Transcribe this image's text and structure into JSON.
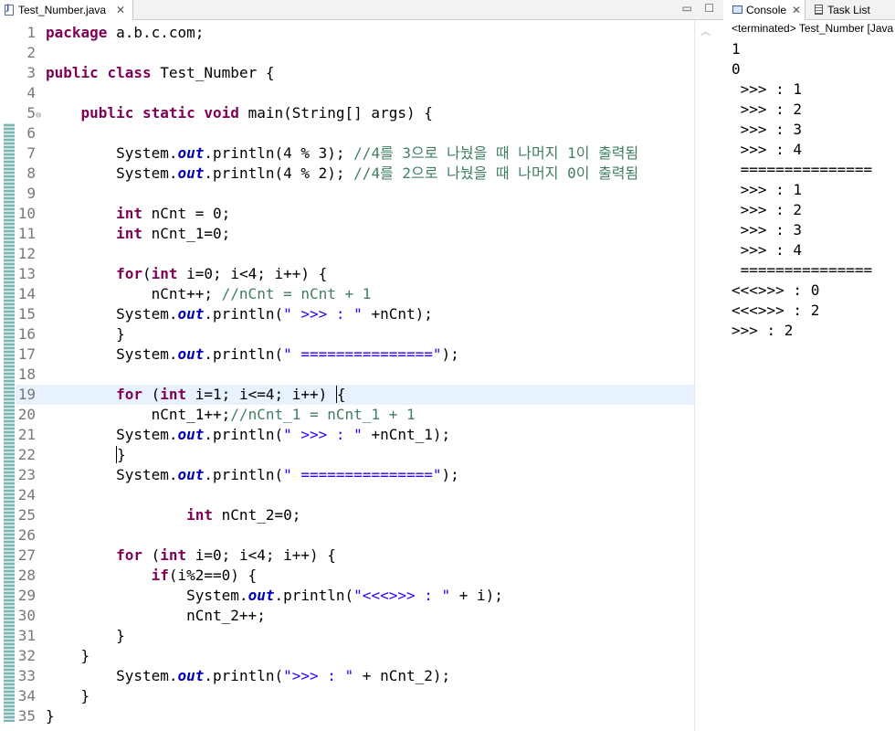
{
  "editor": {
    "tab_label": "Test_Number.java",
    "lines": [
      {
        "n": "1",
        "tokens": [
          [
            "kw",
            "package"
          ],
          [
            "src",
            " a.b.c.com;"
          ]
        ]
      },
      {
        "n": "2",
        "tokens": []
      },
      {
        "n": "3",
        "tokens": [
          [
            "kw",
            "public"
          ],
          [
            "src",
            " "
          ],
          [
            "kw",
            "class"
          ],
          [
            "src",
            " Test_Number {"
          ]
        ]
      },
      {
        "n": "4",
        "tokens": []
      },
      {
        "n": "5",
        "fold": true,
        "tokens": [
          [
            "src",
            "    "
          ],
          [
            "kw",
            "public"
          ],
          [
            "src",
            " "
          ],
          [
            "kw",
            "static"
          ],
          [
            "src",
            " "
          ],
          [
            "kw",
            "void"
          ],
          [
            "src",
            " main(String[] args) {"
          ]
        ]
      },
      {
        "n": "6",
        "tokens": []
      },
      {
        "n": "7",
        "tokens": [
          [
            "src",
            "        System."
          ],
          [
            "fld",
            "out"
          ],
          [
            "src",
            ".println(4 % 3); "
          ],
          [
            "cmt",
            "//4를 3으로 나눴을 때 나머지 1이 출력됨"
          ]
        ]
      },
      {
        "n": "8",
        "tokens": [
          [
            "src",
            "        System."
          ],
          [
            "fld",
            "out"
          ],
          [
            "src",
            ".println(4 % 2); "
          ],
          [
            "cmt",
            "//4를 2으로 나눴을 때 나머지 0이 출력됨"
          ]
        ]
      },
      {
        "n": "9",
        "tokens": []
      },
      {
        "n": "10",
        "tokens": [
          [
            "src",
            "        "
          ],
          [
            "kw",
            "int"
          ],
          [
            "src",
            " nCnt = 0;"
          ]
        ]
      },
      {
        "n": "11",
        "tokens": [
          [
            "src",
            "        "
          ],
          [
            "kw",
            "int"
          ],
          [
            "src",
            " nCnt_1=0;"
          ]
        ]
      },
      {
        "n": "12",
        "tokens": []
      },
      {
        "n": "13",
        "tokens": [
          [
            "src",
            "        "
          ],
          [
            "kw",
            "for"
          ],
          [
            "src",
            "("
          ],
          [
            "kw",
            "int"
          ],
          [
            "src",
            " i=0; i<4; i++) {"
          ]
        ]
      },
      {
        "n": "14",
        "tokens": [
          [
            "src",
            "            nCnt++; "
          ],
          [
            "cmt",
            "//nCnt = nCnt + 1"
          ]
        ]
      },
      {
        "n": "15",
        "tokens": [
          [
            "src",
            "        System."
          ],
          [
            "fld",
            "out"
          ],
          [
            "src",
            ".println("
          ],
          [
            "str",
            "\" >>> : \""
          ],
          [
            "src",
            " +nCnt);"
          ]
        ]
      },
      {
        "n": "16",
        "tokens": [
          [
            "src",
            "        }"
          ]
        ]
      },
      {
        "n": "17",
        "tokens": [
          [
            "src",
            "        System."
          ],
          [
            "fld",
            "out"
          ],
          [
            "src",
            ".println("
          ],
          [
            "str",
            "\" ===============\""
          ],
          [
            "src",
            ");"
          ]
        ]
      },
      {
        "n": "18",
        "tokens": []
      },
      {
        "n": "19",
        "current": true,
        "tokens": [
          [
            "src",
            "        "
          ],
          [
            "kw",
            "for"
          ],
          [
            "src",
            " ("
          ],
          [
            "kw",
            "int"
          ],
          [
            "src",
            " i=1; i<=4; i++) "
          ],
          [
            "caret",
            "{"
          ]
        ]
      },
      {
        "n": "20",
        "tokens": [
          [
            "src",
            "            nCnt_1++;"
          ],
          [
            "cmt",
            "//nCnt_1 = nCnt_1 + 1"
          ]
        ]
      },
      {
        "n": "21",
        "tokens": [
          [
            "src",
            "        System."
          ],
          [
            "fld",
            "out"
          ],
          [
            "src",
            ".println("
          ],
          [
            "str",
            "\" >>> : \""
          ],
          [
            "src",
            " +nCnt_1);"
          ]
        ]
      },
      {
        "n": "22",
        "tokens": [
          [
            "src",
            "        "
          ],
          [
            "caret",
            "}"
          ]
        ]
      },
      {
        "n": "23",
        "tokens": [
          [
            "src",
            "        System."
          ],
          [
            "fld",
            "out"
          ],
          [
            "src",
            ".println("
          ],
          [
            "str",
            "\" ===============\""
          ],
          [
            "src",
            ");"
          ]
        ]
      },
      {
        "n": "24",
        "tokens": []
      },
      {
        "n": "25",
        "tokens": [
          [
            "src",
            "                "
          ],
          [
            "kw",
            "int"
          ],
          [
            "src",
            " nCnt_2=0;"
          ]
        ]
      },
      {
        "n": "26",
        "tokens": []
      },
      {
        "n": "27",
        "tokens": [
          [
            "src",
            "        "
          ],
          [
            "kw",
            "for"
          ],
          [
            "src",
            " ("
          ],
          [
            "kw",
            "int"
          ],
          [
            "src",
            " i=0; i<4; i++) {"
          ]
        ]
      },
      {
        "n": "28",
        "tokens": [
          [
            "src",
            "            "
          ],
          [
            "kw",
            "if"
          ],
          [
            "src",
            "(i%2==0) {"
          ]
        ]
      },
      {
        "n": "29",
        "tokens": [
          [
            "src",
            "                System."
          ],
          [
            "fld",
            "out"
          ],
          [
            "src",
            ".println("
          ],
          [
            "str",
            "\"<<<>>> : \""
          ],
          [
            "src",
            " + i);"
          ]
        ]
      },
      {
        "n": "30",
        "tokens": [
          [
            "src",
            "                nCnt_2++;"
          ]
        ]
      },
      {
        "n": "31",
        "tokens": [
          [
            "src",
            "        }"
          ]
        ]
      },
      {
        "n": "32",
        "tokens": [
          [
            "src",
            "    }"
          ]
        ]
      },
      {
        "n": "33",
        "tokens": [
          [
            "src",
            "        System."
          ],
          [
            "fld",
            "out"
          ],
          [
            "src",
            ".println("
          ],
          [
            "str",
            "\">>> : \""
          ],
          [
            "src",
            " + nCnt_2);"
          ]
        ]
      },
      {
        "n": "34",
        "tokens": [
          [
            "src",
            "    }"
          ]
        ]
      },
      {
        "n": "35",
        "tokens": [
          [
            "src",
            "}"
          ]
        ]
      }
    ]
  },
  "console": {
    "tab_label": "Console",
    "tasklist_label": "Task List",
    "terminated": "<terminated> Test_Number [Java",
    "output": [
      "1",
      "0",
      " >>> : 1",
      " >>> : 2",
      " >>> : 3",
      " >>> : 4",
      " ===============",
      " >>> : 1",
      " >>> : 2",
      " >>> : 3",
      " >>> : 4",
      " ===============",
      "<<<>>> : 0",
      "<<<>>> : 2",
      ">>> : 2"
    ]
  },
  "icons": {
    "tab_close": "close-icon",
    "minimize": "minimize-icon",
    "maximize": "maximize-icon",
    "scroll_up": "scroll-up-icon"
  }
}
